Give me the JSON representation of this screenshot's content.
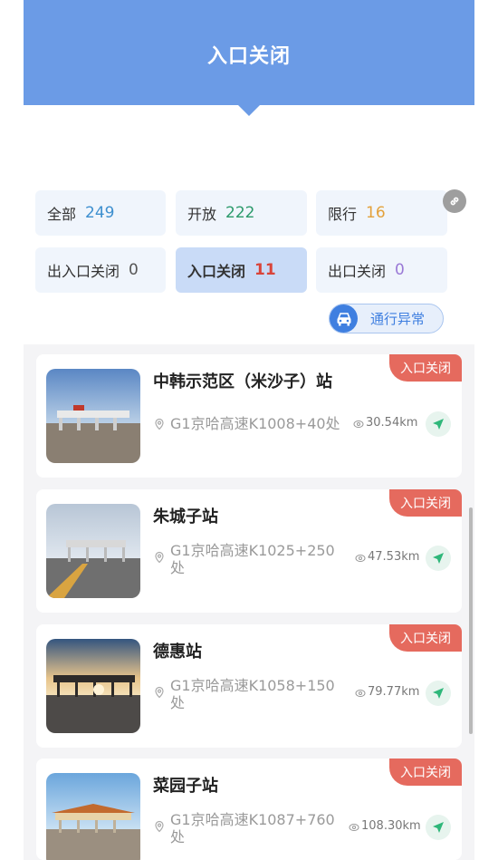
{
  "header": {
    "title": "入口关闭"
  },
  "filters": [
    {
      "label": "全部",
      "count": "249",
      "color": "#3d8fcf"
    },
    {
      "label": "开放",
      "count": "222",
      "color": "#2b9a6b"
    },
    {
      "label": "限行",
      "count": "16",
      "color": "#e3a13a"
    },
    {
      "label": "出入口关闭",
      "count": "0",
      "color": "#555555"
    },
    {
      "label": "入口关闭",
      "count": "11",
      "color": "#d9443a",
      "selected": true
    },
    {
      "label": "出口关闭",
      "count": "0",
      "color": "#9a79d6"
    }
  ],
  "traffic_button": {
    "label": "通行异常",
    "icon": "car-icon"
  },
  "link_button": {
    "icon": "link-icon"
  },
  "stations": [
    {
      "name": "中韩示范区（米沙子）站",
      "address": "G1京哈高速K1008+40处",
      "distance": "30.54km",
      "status": "入口关闭"
    },
    {
      "name": "朱城子站",
      "address": "G1京哈高速K1025+250处",
      "distance": "47.53km",
      "status": "入口关闭"
    },
    {
      "name": "德惠站",
      "address": "G1京哈高速K1058+150处",
      "distance": "79.77km",
      "status": "入口关闭"
    },
    {
      "name": "菜园子站",
      "address": "G1京哈高速K1087+760处",
      "distance": "108.30km",
      "status": "入口关闭"
    }
  ],
  "colors": {
    "accent": "#6b9be6",
    "badge": "#e56a5e",
    "nav": "#2fb77a"
  }
}
